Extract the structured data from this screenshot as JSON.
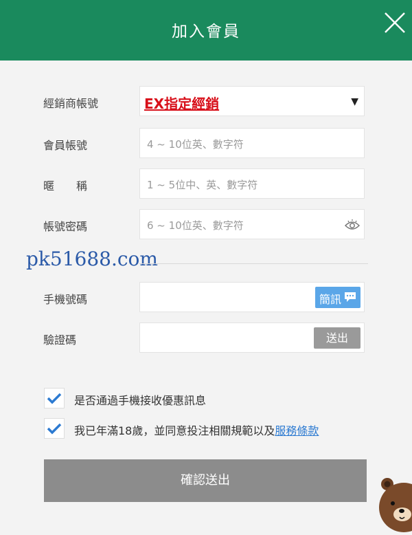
{
  "header": {
    "title": "加入會員",
    "close_icon": "close-icon"
  },
  "form": {
    "dealer": {
      "label": "經銷商帳號",
      "value": "EX指定經銷",
      "caret": "▼"
    },
    "account": {
      "label": "會員帳號",
      "placeholder": "4 ~ 10位英、數字符"
    },
    "nickname": {
      "label": "暱　　稱",
      "placeholder": "1 ~ 5位中、英、數字符"
    },
    "password": {
      "label": "帳號密碼",
      "placeholder": "6 ~ 10位英、數字符",
      "icon": "eye-icon"
    },
    "phone": {
      "label": "手機號碼",
      "sms_button": "簡訊",
      "sms_icon": "chat-bubble-icon"
    },
    "verify": {
      "label": "驗證碼",
      "send_button": "送出"
    }
  },
  "watermark": "pk51688.com",
  "checks": {
    "promo": {
      "text": "是否通過手機接收優惠訊息",
      "checked": true
    },
    "age": {
      "text": "我已年滿18歲，並同意投注相關規範以及",
      "link": "服務條款",
      "checked": true
    }
  },
  "submit_label": "確認送出",
  "colors": {
    "header": "#1a8a5d",
    "dealer_value": "#d8101a",
    "sms_button": "#5aa6e8",
    "check": "#2c7ad1"
  }
}
